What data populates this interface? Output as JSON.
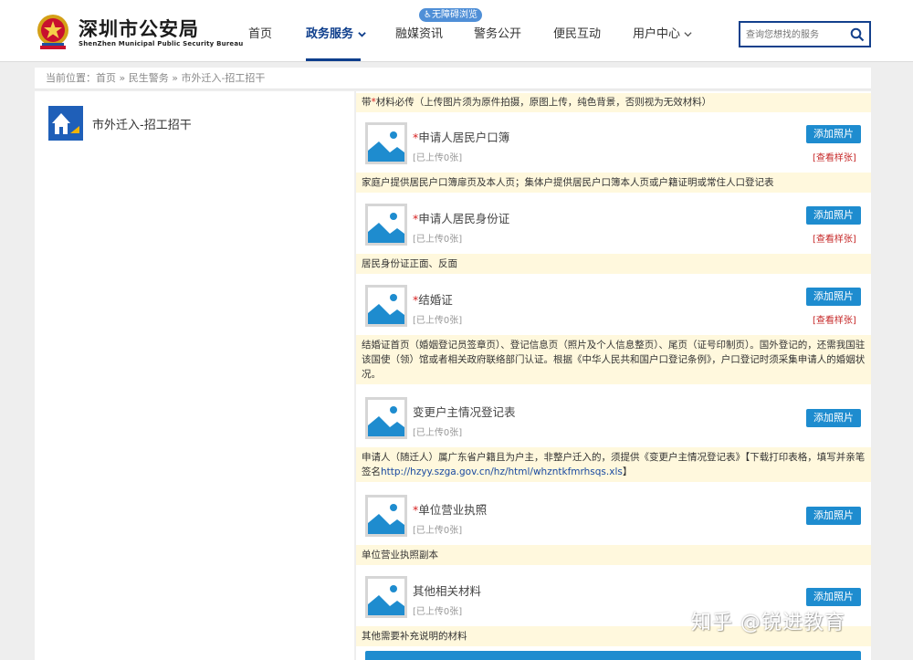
{
  "header": {
    "title": "深圳市公安局",
    "subtitle": "ShenZhen Municipal Public Security Bureau",
    "access_badge": "♿无障碍浏览",
    "nav": [
      "首页",
      "政务服务",
      "融媒资讯",
      "警务公开",
      "便民互动",
      "用户中心"
    ],
    "search_placeholder": "查询您想找的服务"
  },
  "breadcrumb": "当前位置：首页 » 民生警务 » 市外迁入-招工招干",
  "left": {
    "service_title": "市外迁入-招工招干"
  },
  "right": {
    "note_prefix": "带",
    "note_star": "*",
    "note_text": "材料必传（上传图片须为原件拍摄，原图上传，纯色背景，否则视为无效材料）",
    "add_label": "添加照片",
    "sample_label": "[查看样张]",
    "uploaded": "[已上传0张]",
    "required_mark": "*",
    "items": [
      {
        "title": "申请人居民户口簿",
        "desc": "家庭户提供居民户口簿扉页及本人页；集体户提供居民户口簿本人页或户籍证明或常住人口登记表"
      },
      {
        "title": "申请人居民身份证",
        "desc": "居民身份证正面、反面"
      },
      {
        "title": "结婚证",
        "desc": "结婚证首页（婚姻登记员签章页）、登记信息页（照片及个人信息整页）、尾页（证号印制页）。国外登记的，还需我国驻该国使（领）馆或者相关政府联络部门认证。根据《中华人民共和国户口登记条例》，户口登记时须采集申请人的婚姻状况。"
      },
      {
        "title": "变更户主情况登记表",
        "desc": "申请人（随迁人）属广东省户籍且为户主，非整户迁入的，须提供《变更户主情况登记表》【下载打印表格，填写并亲笔签名",
        "desc_link": "http://hzyy.szga.gov.cn/hz/html/whzntkfmrhsqs.xls",
        "desc_end": "】"
      },
      {
        "title": "单位营业执照",
        "desc": "单位营业执照副本"
      },
      {
        "title": "其他相关材料",
        "desc": "其他需要补充说明的材料"
      }
    ]
  },
  "watermark": "知乎 @锐进教育"
}
